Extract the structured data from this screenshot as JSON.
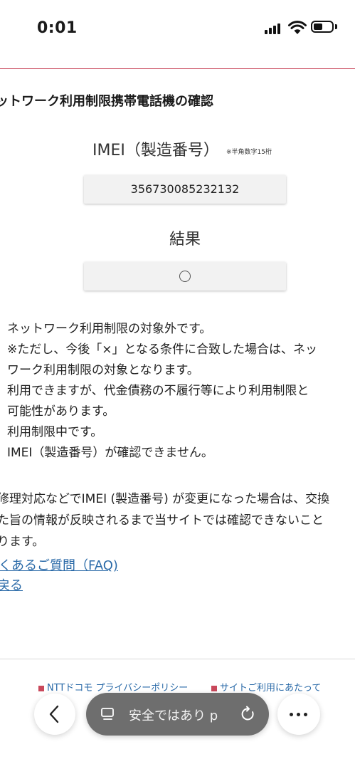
{
  "status_bar": {
    "time": "0:01"
  },
  "page": {
    "title": "ットワーク利用制限携帯電話機の確認",
    "imei_label": "IMEI（製造番号）",
    "imei_note": "※半角数字15桁",
    "imei_value": "356730085232132",
    "result_label": "結果",
    "result_value": "○"
  },
  "legend": [
    "ネットワーク利用制限の対象外です。",
    "※ただし、今後「×」となる条件に合致した場合は、ネッ",
    "ワーク利用制限の対象となります。",
    "利用できますが、代金債務の不履行等により利用制限と",
    "可能性があります。",
    "利用制限中です。",
    "IMEI（製造番号）が確認できません。"
  ],
  "notice": [
    "修理対応などでIMEI (製造番号) が変更になった場合は、交換",
    "た旨の情報が反映されるまで当サイトでは確認できないこと",
    "ります。"
  ],
  "links": {
    "faq": "くあるご質問（FAQ)",
    "back": "戻る"
  },
  "footer": {
    "links": [
      "NTTドコモ プライバシーポリシー",
      "サイトご利用にあたって"
    ]
  },
  "browser": {
    "url_text": "安全ではあり    p"
  }
}
